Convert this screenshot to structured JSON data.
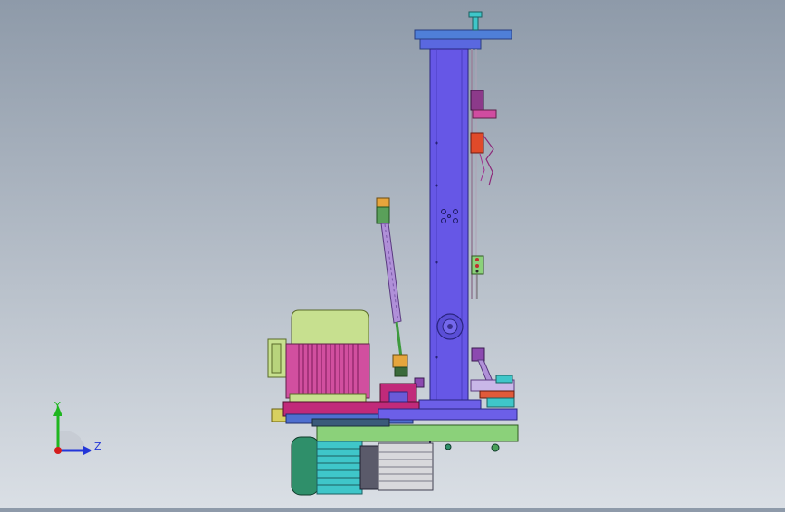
{
  "view": {
    "background_top": "#8e9aa9",
    "background_bottom": "#dadfe5"
  },
  "triad": {
    "y_label": "Y",
    "z_label": "Z",
    "y_color": "#1fb61f",
    "z_color": "#2336d8",
    "x_color": "#d41c1c"
  },
  "colors": {
    "column": "#6657e6",
    "column_dark": "#4a3cc0",
    "motor_body": "#d14f9f",
    "motor_cap": "#c7e08f",
    "base_plate": "#c12a7a",
    "frame_green": "#8bd17a",
    "gear_motor": "#2f8f6a",
    "teal": "#3fc6c9"
  }
}
